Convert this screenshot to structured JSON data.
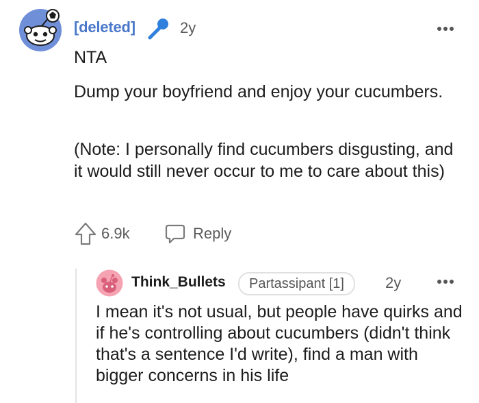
{
  "comment": {
    "author": "[deleted]",
    "time": "2y",
    "paragraphs": [
      "NTA",
      "Dump your boyfriend and enjoy your cucumbers.",
      "(Note: I personally find cucumbers disgusting, and it would still never occur to me to care about this)"
    ],
    "score": "6.9k",
    "reply_label": "Reply",
    "avatar_icon": "snoo-avatar-icon",
    "award_icon": "microphone-icon",
    "accent_color": "#4a78c9"
  },
  "reply": {
    "author": "Think_Bullets",
    "flair": "Partassipant [1]",
    "time": "2y",
    "text": "I mean it's not usual, but people have quirks and if he's controlling about cucumbers (didn't think that's a sentence I'd write), find a man with bigger concerns in his life",
    "avatar_icon": "snoo-avatar-icon",
    "avatar_color": "#f5a3b3"
  }
}
